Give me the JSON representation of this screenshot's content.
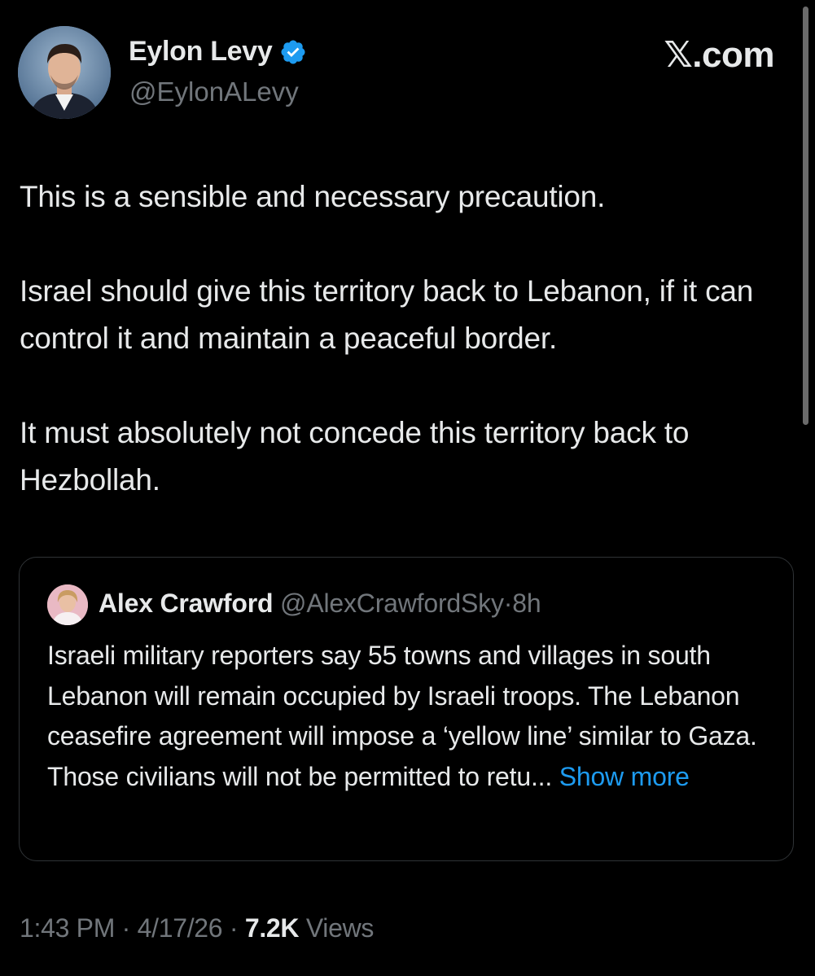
{
  "author": {
    "name": "Eylon Levy",
    "handle": "@EylonALevy",
    "verified": true
  },
  "brand": "𝕏.com",
  "tweet": {
    "paragraphs": [
      "This is a sensible and necessary precaution.",
      "Israel should give this territory back to Lebanon, if it can control it and maintain a peaceful border.",
      "It must absolutely not concede this territory back to Hezbollah."
    ]
  },
  "quote": {
    "name": "Alex Crawford",
    "handle": "@AlexCrawfordSky",
    "separator": "·",
    "time": "8h",
    "text": "Israeli military reporters say 55 towns and villages in south Lebanon will remain occupied by Israeli troops. The Lebanon ceasefire agreement will impose a ‘yellow line’ similar to Gaza. Those civilians will not be permitted to retu...",
    "show_more": "Show more"
  },
  "meta": {
    "time": "1:43 PM",
    "separator": "·",
    "date": "4/17/26",
    "views_count": "7.2K",
    "views_label": "Views"
  },
  "colors": {
    "background": "#000000",
    "text_primary": "#e7e9ea",
    "text_secondary": "#71767b",
    "accent_blue": "#1d9bf0",
    "card_border": "#2f3336"
  }
}
